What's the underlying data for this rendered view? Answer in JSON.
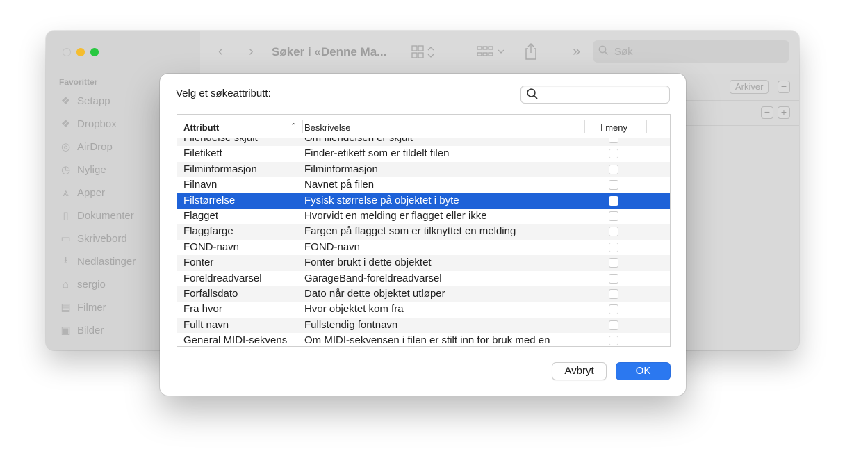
{
  "finder": {
    "title": "Søker i «Denne Ma...",
    "search_placeholder": "Søk",
    "sidebar_header": "Favoritter",
    "sidebar_items": [
      {
        "label": "Setapp",
        "icon": "setapp-icon"
      },
      {
        "label": "Dropbox",
        "icon": "dropbox-icon"
      },
      {
        "label": "AirDrop",
        "icon": "airdrop-icon"
      },
      {
        "label": "Nylige",
        "icon": "clock-icon"
      },
      {
        "label": "Apper",
        "icon": "apps-icon"
      },
      {
        "label": "Dokumenter",
        "icon": "document-icon"
      },
      {
        "label": "Skrivebord",
        "icon": "desktop-icon"
      },
      {
        "label": "Nedlastinger",
        "icon": "download-icon"
      },
      {
        "label": "sergio",
        "icon": "home-icon"
      },
      {
        "label": "Filmer",
        "icon": "film-icon"
      },
      {
        "label": "Bilder",
        "icon": "photo-icon"
      }
    ],
    "save_label": "Arkiver",
    "minus_glyph": "−",
    "plus_glyph": "+"
  },
  "dialog": {
    "prompt": "Velg et søkeattributt:",
    "search_value": "",
    "columns": {
      "attribute": "Attributt",
      "description": "Beskrivelse",
      "in_menu": "I meny"
    },
    "rows": [
      {
        "attribute": "Filendelse skjult",
        "description": "Om filendelsen er skjult",
        "selected": false
      },
      {
        "attribute": "Filetikett",
        "description": "Finder-etikett som er tildelt filen",
        "selected": false
      },
      {
        "attribute": "Filminformasjon",
        "description": "Filminformasjon",
        "selected": false
      },
      {
        "attribute": "Filnavn",
        "description": "Navnet på filen",
        "selected": false
      },
      {
        "attribute": "Filstørrelse",
        "description": "Fysisk størrelse på objektet i byte",
        "selected": true
      },
      {
        "attribute": "Flagget",
        "description": "Hvorvidt en melding er flagget eller ikke",
        "selected": false
      },
      {
        "attribute": "Flaggfarge",
        "description": "Fargen på flagget som er tilknyttet en melding",
        "selected": false
      },
      {
        "attribute": "FOND-navn",
        "description": "FOND-navn",
        "selected": false
      },
      {
        "attribute": "Fonter",
        "description": "Fonter brukt i dette objektet",
        "selected": false
      },
      {
        "attribute": "Foreldreadvarsel",
        "description": "GarageBand-foreldreadvarsel",
        "selected": false
      },
      {
        "attribute": "Forfallsdato",
        "description": "Dato når dette objektet utløper",
        "selected": false
      },
      {
        "attribute": "Fra hvor",
        "description": "Hvor objektet kom fra",
        "selected": false
      },
      {
        "attribute": "Fullt navn",
        "description": "Fullstendig fontnavn",
        "selected": false
      },
      {
        "attribute": "General MIDI-sekvens",
        "description": "Om MIDI-sekvensen i filen er stilt inn for bruk med en",
        "selected": false
      }
    ],
    "cancel_label": "Avbryt",
    "ok_label": "OK"
  },
  "colors": {
    "selection": "#1e62d8",
    "ok_button": "#2b78f0",
    "traffic_red": "#d7d7d7",
    "traffic_yellow": "#f5bd2f",
    "traffic_green": "#28c840"
  }
}
